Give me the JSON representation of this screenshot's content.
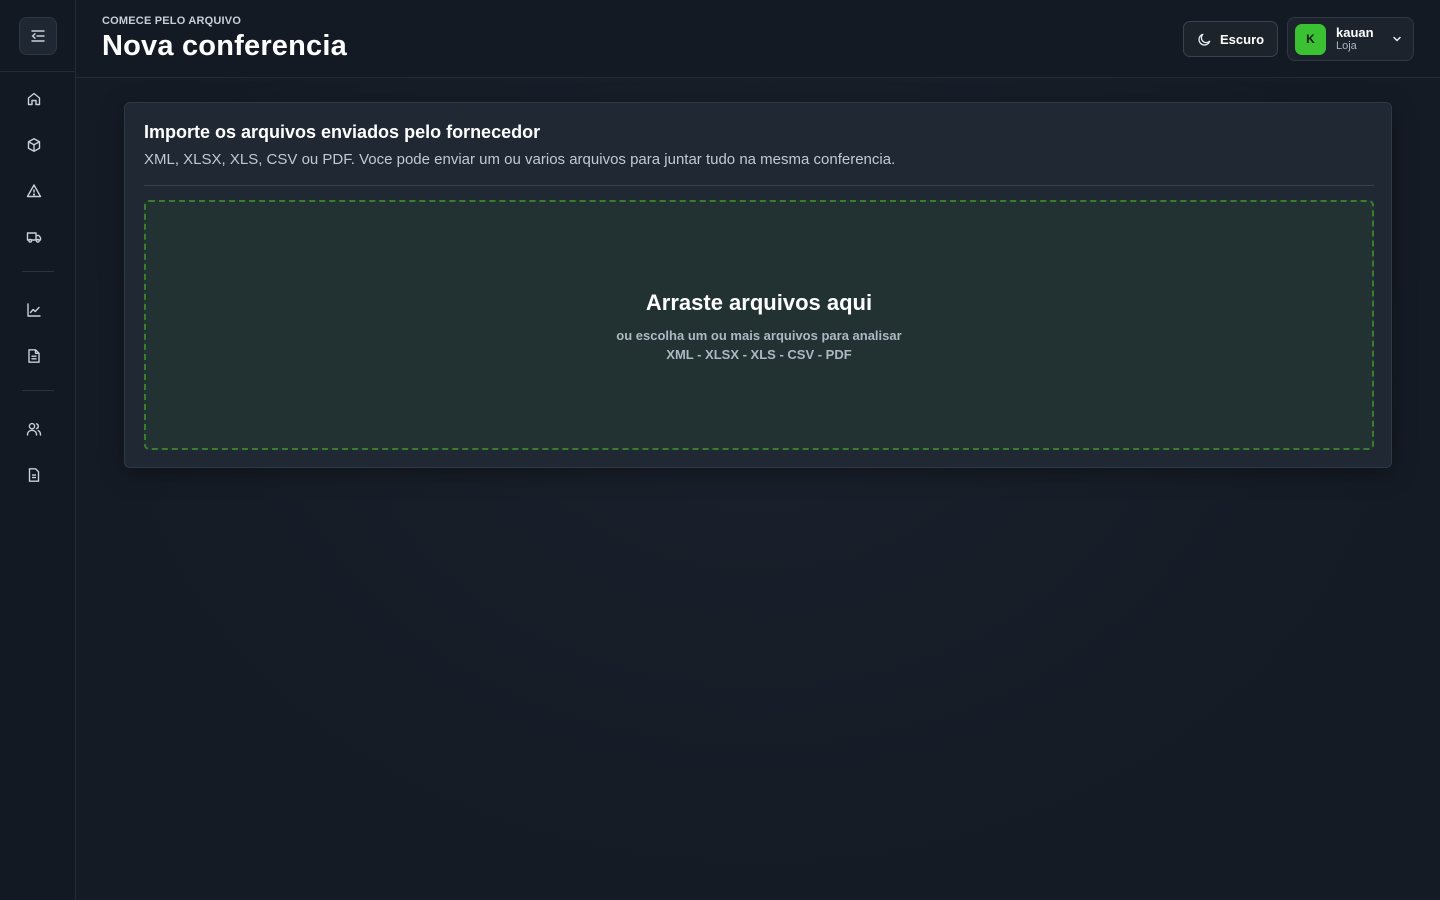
{
  "sidebar": {
    "collapse_icon": "collapse-sidebar-icon",
    "items": [
      {
        "icon": "home-icon"
      },
      {
        "icon": "box-icon"
      },
      {
        "icon": "alert-triangle-icon"
      },
      {
        "icon": "truck-icon"
      },
      {
        "icon": "chart-line-icon"
      },
      {
        "icon": "file-text-icon"
      },
      {
        "icon": "users-icon"
      },
      {
        "icon": "file-icon"
      }
    ]
  },
  "header": {
    "eyebrow": "COMECE PELO ARQUIVO",
    "title": "Nova conferencia",
    "theme_button": {
      "label": "Escuro",
      "icon": "moon-icon"
    },
    "user": {
      "initial": "K",
      "name": "kauan",
      "role": "Loja",
      "avatar_color": "#3bc233"
    }
  },
  "card": {
    "title": "Importe os arquivos enviados pelo fornecedor",
    "description": "XML, XLSX, XLS, CSV ou PDF. Voce pode enviar um ou varios arquivos para juntar tudo na mesma conferencia.",
    "dropzone": {
      "title": "Arraste arquivos aqui",
      "subtitle": "ou escolha um ou mais arquivos para analisar",
      "formats": "XML - XLSX - XLS - CSV - PDF"
    }
  },
  "colors": {
    "background": "#151b25",
    "accent": "#3bc233",
    "dropzone_border": "#3b7d2e"
  }
}
